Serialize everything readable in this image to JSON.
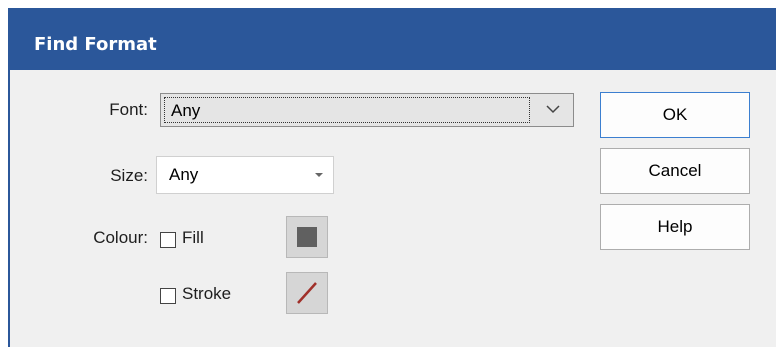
{
  "dialog": {
    "title": "Find Format"
  },
  "form": {
    "font_label": "Font:",
    "font_value": "Any",
    "size_label": "Size:",
    "size_value": "Any",
    "colour_label": "Colour:",
    "fill_label": "Fill",
    "fill_checked": false,
    "stroke_label": "Stroke",
    "stroke_checked": false,
    "fill_swatch_color": "#606060",
    "stroke_swatch_color": "#a0302a"
  },
  "buttons": {
    "ok": "OK",
    "cancel": "Cancel",
    "help": "Help"
  },
  "colors": {
    "titlebar": "#2b579a",
    "dialog_bg": "#f0f0f0",
    "default_button_border": "#3c7fd0"
  },
  "icons": {
    "font_dropdown": "chevron-down-icon",
    "size_dropdown": "caret-down-icon",
    "fill_swatch": "filled-square-icon",
    "stroke_swatch": "diagonal-line-icon"
  }
}
